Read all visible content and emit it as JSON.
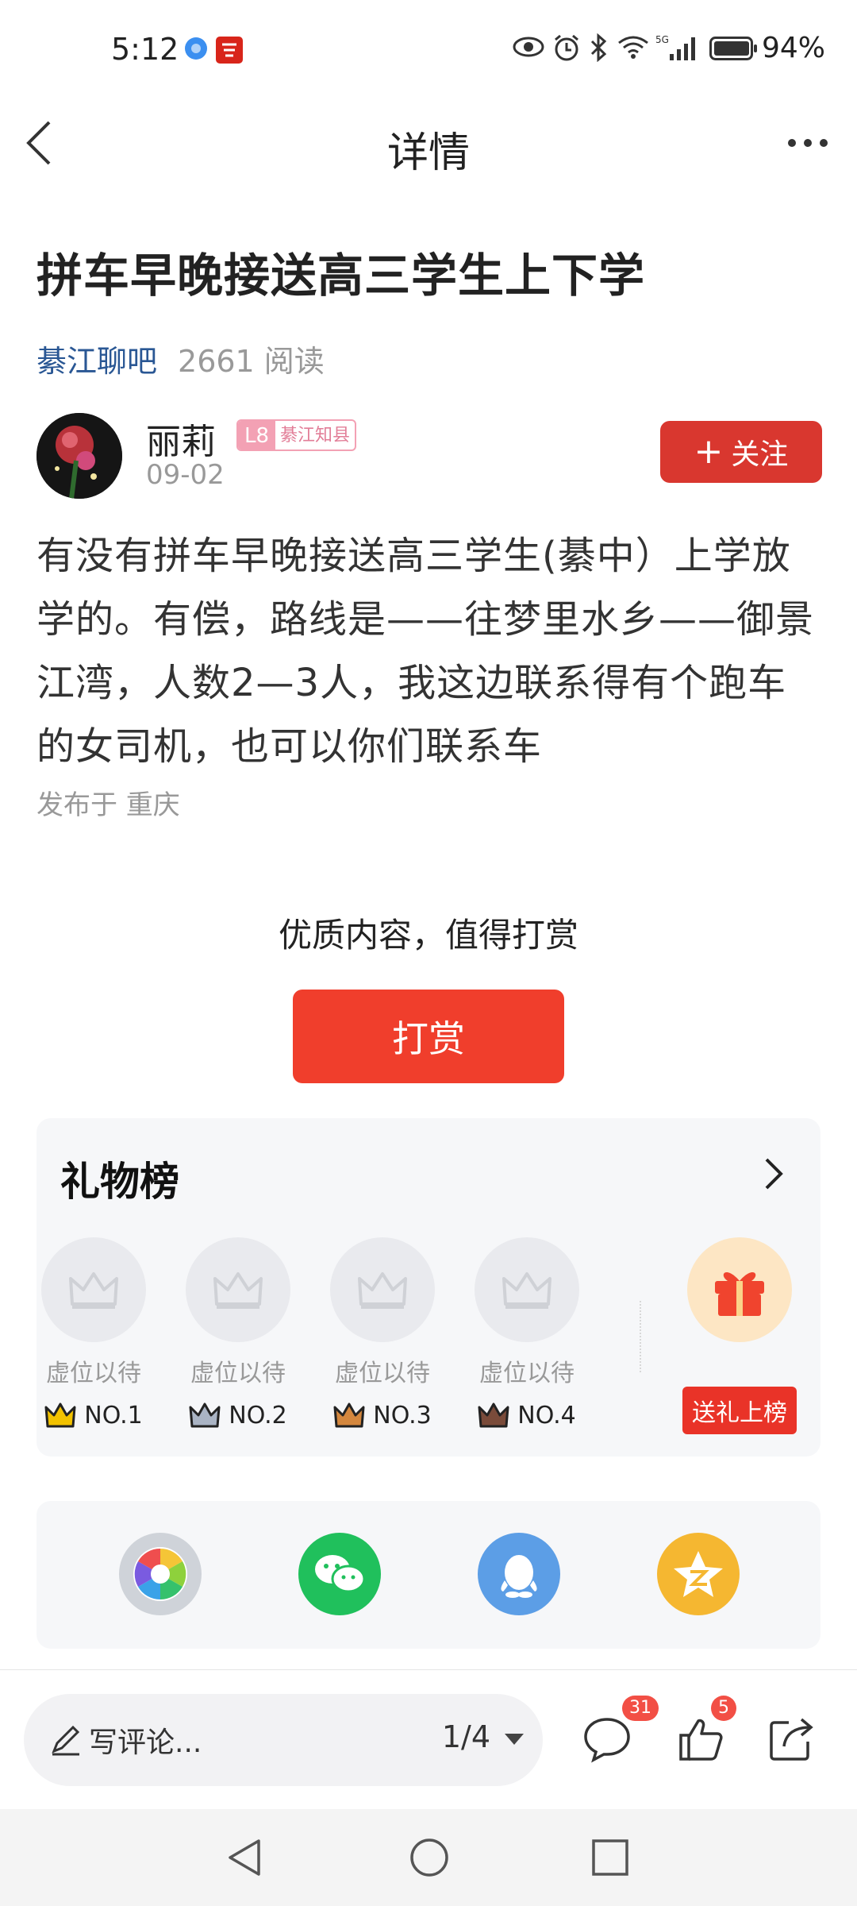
{
  "status_bar": {
    "time": "5:12",
    "battery": "94%"
  },
  "nav": {
    "title": "详情"
  },
  "post": {
    "title": "拼车早晚接送高三学生上下学",
    "forum": "綦江聊吧",
    "reads": "2661 阅读",
    "content": "有没有拼车早晚接送高三学生(綦中）上学放学的。有偿，路线是——往梦里水乡——御景江湾，人数2—3人，我这边联系得有个跑车的女司机，也可以你们联系车",
    "location": "发布于 重庆"
  },
  "author": {
    "name": "丽莉",
    "level": "L8",
    "level_title": "綦江知县",
    "date": "09-02",
    "follow_label": "关注"
  },
  "reward": {
    "prompt": "优质内容，值得打赏",
    "button": "打赏"
  },
  "gift_board": {
    "title": "礼物榜",
    "slots": [
      {
        "placeholder": "虚位以待",
        "rank": "NO.1",
        "crown_color": "#f2c200"
      },
      {
        "placeholder": "虚位以待",
        "rank": "NO.2",
        "crown_color": "#aab4c4"
      },
      {
        "placeholder": "虚位以待",
        "rank": "NO.3",
        "crown_color": "#d4873e"
      },
      {
        "placeholder": "虚位以待",
        "rank": "NO.4",
        "crown_color": "#7a4b3a"
      }
    ],
    "send_label": "送礼上榜"
  },
  "share": [
    "moments-icon",
    "wechat-icon",
    "qq-icon",
    "qzone-icon"
  ],
  "bottom_bar": {
    "comment_placeholder": "写评论...",
    "page_indicator": "1/4",
    "comment_count": "31",
    "like_count": "5"
  },
  "colors": {
    "accent": "#f03e2c",
    "follow": "#d9372f",
    "forum_link": "#2a5794"
  }
}
